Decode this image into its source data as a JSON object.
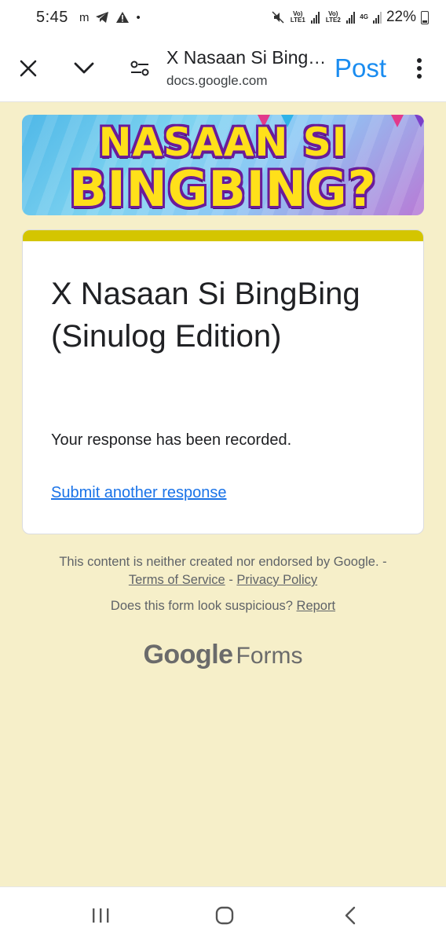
{
  "status_bar": {
    "time": "5:45",
    "notification_icons": [
      "m",
      "telegram-icon",
      "warning-icon",
      "dot"
    ],
    "sim1_label": "Vo) LTE1",
    "sim2_label": "Vo) LTE2",
    "network_label": "4G",
    "battery": "22%"
  },
  "toolbar": {
    "title": "X Nasaan Si BingBing (Sinulog Edition)",
    "url": "docs.google.com",
    "post_label": "Post"
  },
  "banner": {
    "line1": "NASAAN SI",
    "line2": "BINGBING?"
  },
  "form": {
    "accent_color": "#d4c500",
    "title": "X Nasaan Si BingBing (Sinulog Edition)",
    "confirmation": "Your response has been recorded.",
    "submit_another": "Submit another response"
  },
  "footer": {
    "disclaimer": "This content is neither created nor endorsed by Google. -",
    "terms": "Terms of Service",
    "sep": "-",
    "privacy": "Privacy Policy",
    "suspicious": "Does this form look suspicious?",
    "report": "Report",
    "brand_google": "Google",
    "brand_forms": "Forms"
  },
  "colors": {
    "page_bg": "#f6efc9",
    "link": "#1a73e8",
    "post_blue": "#1a8cf0"
  }
}
